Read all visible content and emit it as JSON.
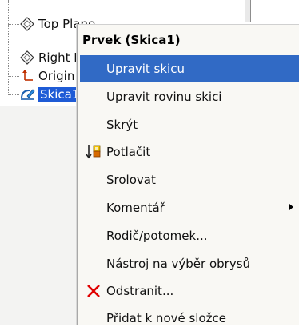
{
  "tree": {
    "items": [
      {
        "label": "Top Plane",
        "icon": "plane-icon"
      },
      {
        "label": "Right Plane",
        "icon": "plane-icon"
      },
      {
        "label": "Origin",
        "icon": "origin-icon"
      },
      {
        "label": "Skica1",
        "icon": "sketch-icon",
        "selected": true
      }
    ]
  },
  "context_menu": {
    "title": "Prvek (Skica1)",
    "items": [
      {
        "label": "Upravit skicu",
        "highlighted": true
      },
      {
        "label": "Upravit rovinu skici"
      },
      {
        "label": "Skrýt"
      },
      {
        "label": "Potlačit",
        "icon": "suppress-icon"
      },
      {
        "label": "Srolovat"
      },
      {
        "label": "Komentář",
        "submenu": true
      },
      {
        "label": "Rodič/potomek..."
      },
      {
        "label": "Nástroj na výběr obrysů"
      },
      {
        "label": "Odstranit...",
        "icon": "delete-x-icon"
      },
      {
        "label": "Přidat k nové složce"
      }
    ]
  },
  "colors": {
    "highlight": "#316ac5",
    "selection": "#1e5bd6",
    "delete_icon": "#e00000"
  }
}
